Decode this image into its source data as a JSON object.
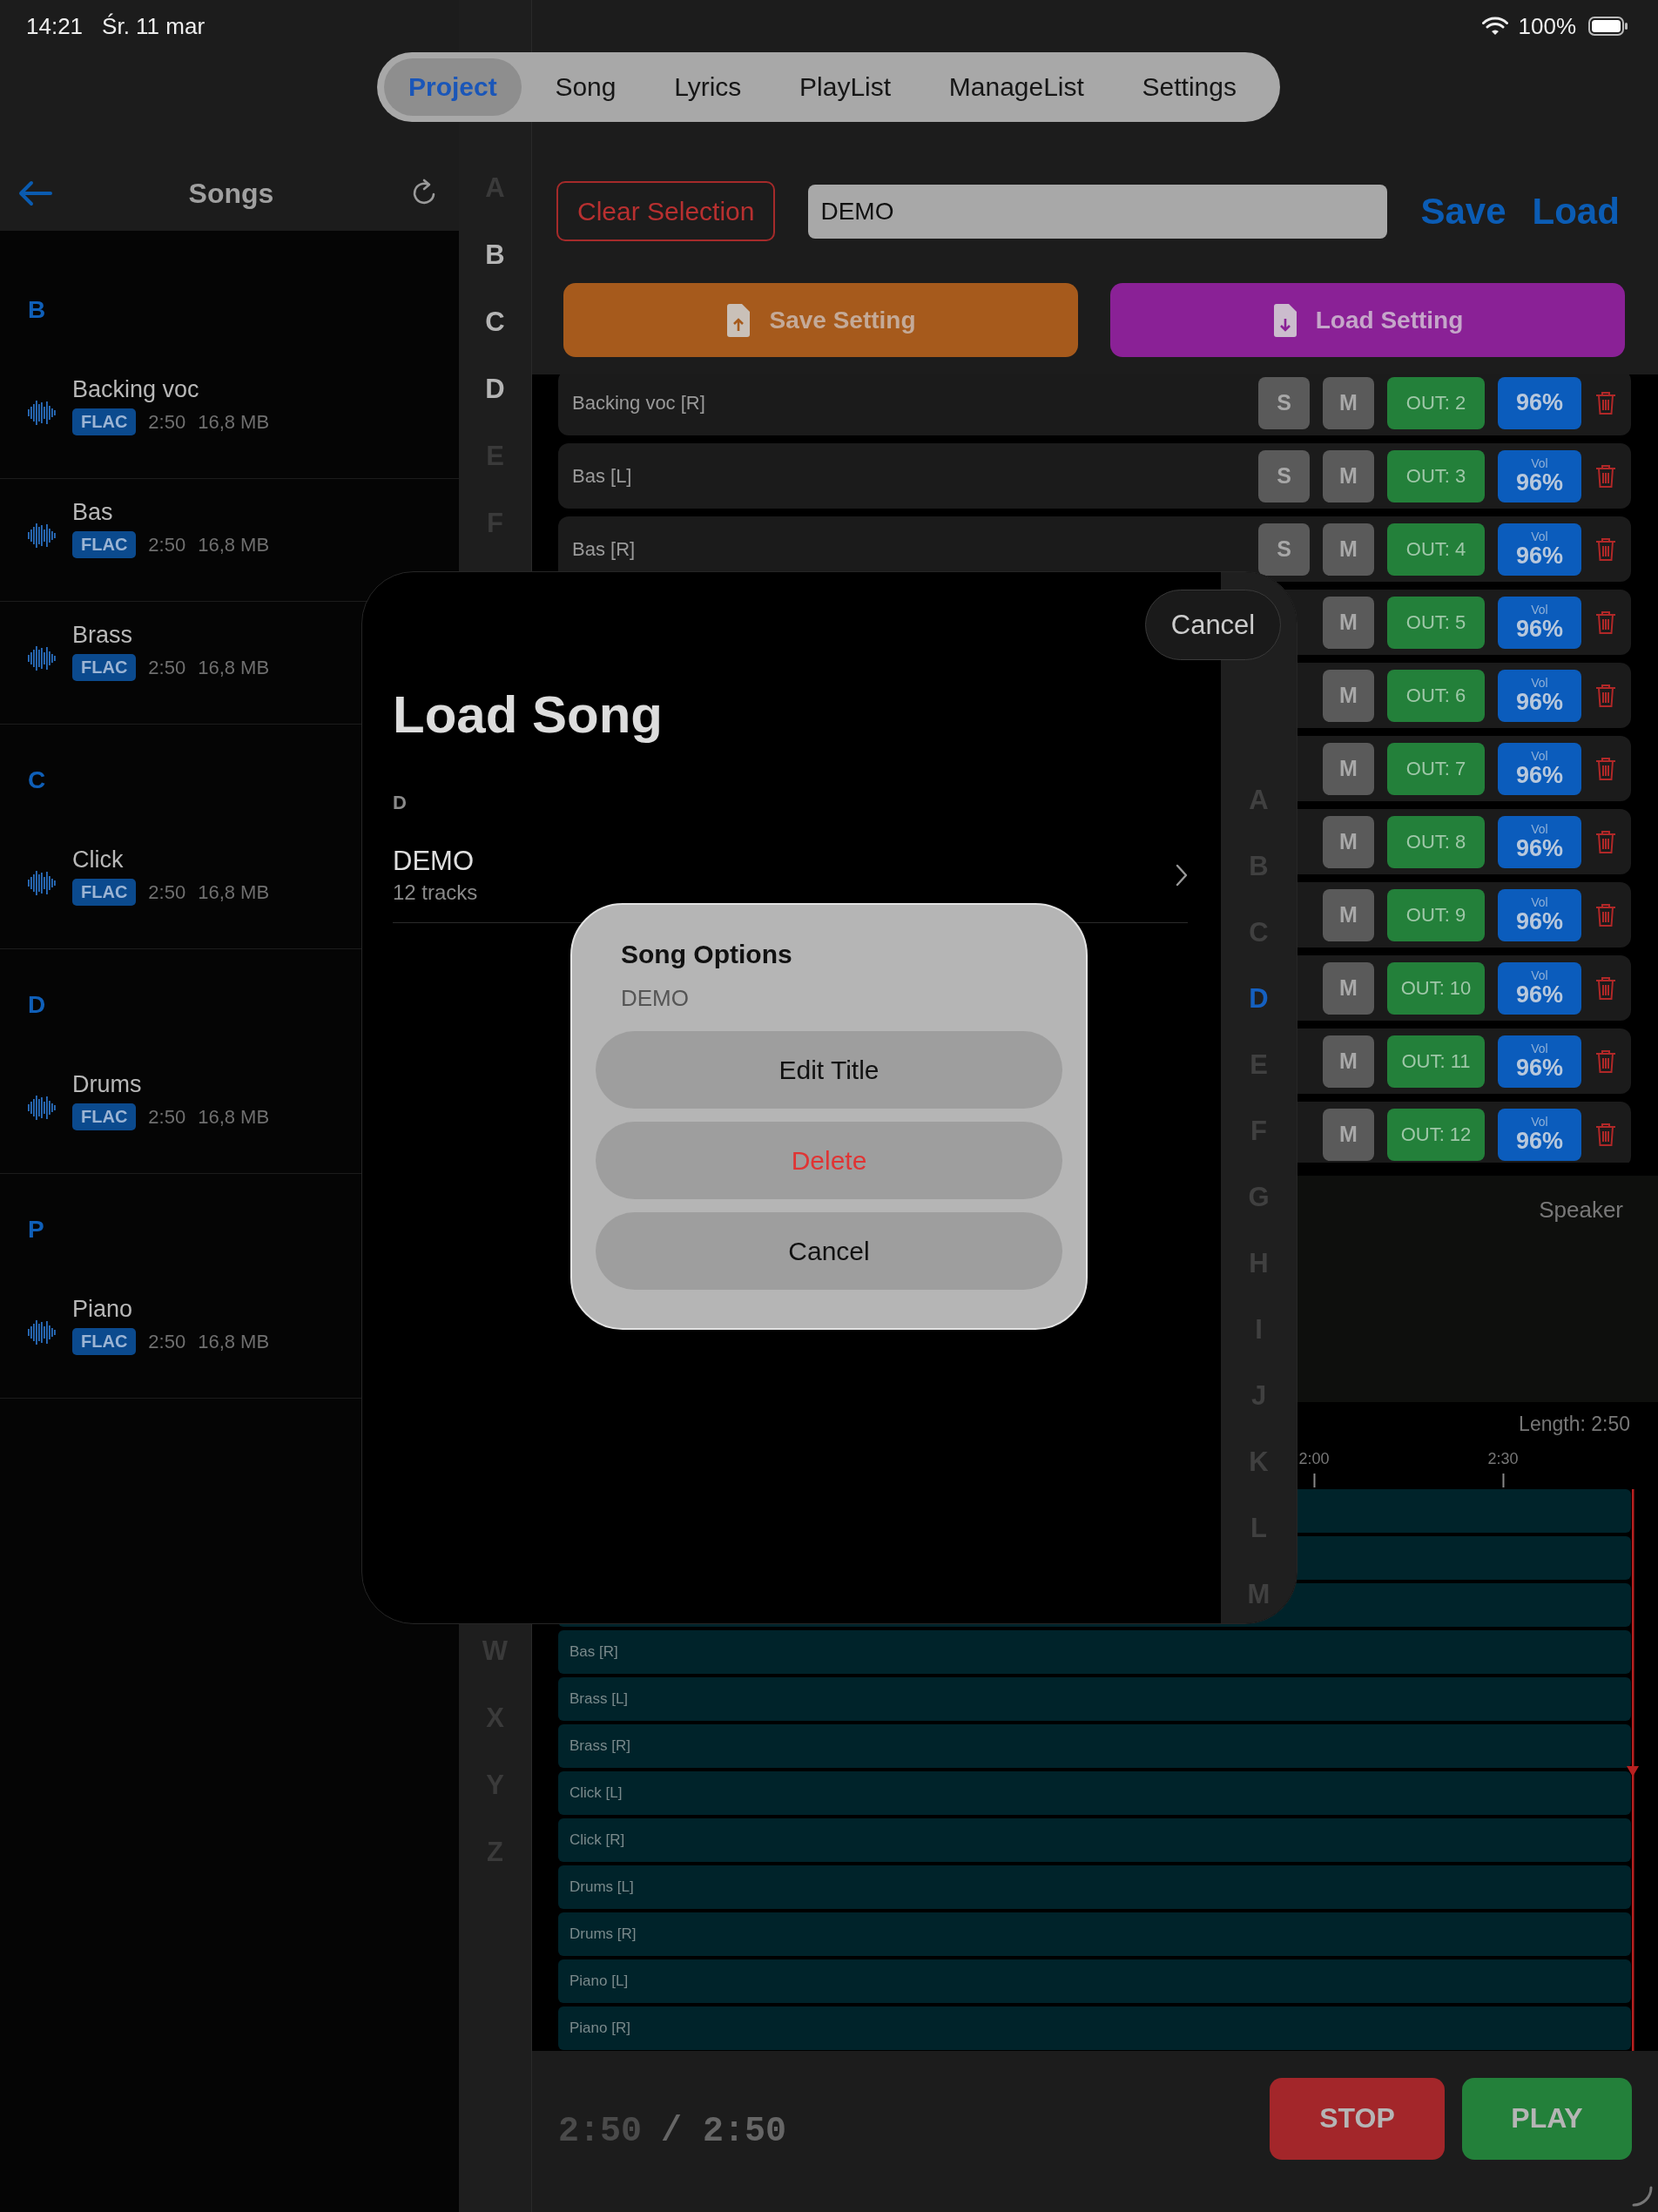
{
  "status_bar": {
    "time": "14:21",
    "date": "Śr. 11 mar",
    "battery": "100%"
  },
  "tabs": [
    {
      "label": "Project",
      "selected": true
    },
    {
      "label": "Song",
      "selected": false
    },
    {
      "label": "Lyrics",
      "selected": false
    },
    {
      "label": "PlayList",
      "selected": false
    },
    {
      "label": "ManageList",
      "selected": false
    },
    {
      "label": "Settings",
      "selected": false
    }
  ],
  "songs_sidebar": {
    "title": "Songs",
    "sections": [
      {
        "letter": "B",
        "songs": [
          {
            "name": "Backing voc",
            "format": "FLAC",
            "duration": "2:50",
            "size": "16,8 MB"
          },
          {
            "name": "Bas",
            "format": "FLAC",
            "duration": "2:50",
            "size": "16,8 MB"
          },
          {
            "name": "Brass",
            "format": "FLAC",
            "duration": "2:50",
            "size": "16,8 MB"
          }
        ]
      },
      {
        "letter": "C",
        "songs": [
          {
            "name": "Click",
            "format": "FLAC",
            "duration": "2:50",
            "size": "16,8 MB"
          }
        ]
      },
      {
        "letter": "D",
        "songs": [
          {
            "name": "Drums",
            "format": "FLAC",
            "duration": "2:50",
            "size": "16,8 MB"
          }
        ]
      },
      {
        "letter": "P",
        "songs": [
          {
            "name": "Piano",
            "format": "FLAC",
            "duration": "2:50",
            "size": "16,8 MB"
          }
        ]
      }
    ]
  },
  "index_top": [
    {
      "letter": "A",
      "enabled": false
    },
    {
      "letter": "B",
      "enabled": true
    },
    {
      "letter": "C",
      "enabled": true
    },
    {
      "letter": "D",
      "enabled": true
    },
    {
      "letter": "E",
      "enabled": false
    },
    {
      "letter": "F",
      "enabled": false
    }
  ],
  "index_bottom": [
    {
      "letter": "W",
      "enabled": false
    },
    {
      "letter": "X",
      "enabled": false
    },
    {
      "letter": "Y",
      "enabled": false
    },
    {
      "letter": "Z",
      "enabled": false
    }
  ],
  "project": {
    "clear_button": "Clear Selection",
    "name_value": "DEMO",
    "save": "Save",
    "load": "Load",
    "save_setting": "Save Setting",
    "load_setting": "Load Setting"
  },
  "tracks": [
    {
      "name": "Backing voc [R]",
      "solo": "S",
      "mute": "M",
      "output": "OUT: 2",
      "volume": "96%"
    },
    {
      "name": "Bas [L]",
      "solo": "S",
      "mute": "M",
      "output": "OUT: 3",
      "volume_caption": "Vol",
      "volume": "96%"
    },
    {
      "name": "Bas [R]",
      "solo": "S",
      "mute": "M",
      "output": "OUT: 4",
      "volume_caption": "Vol",
      "volume": "96%"
    },
    {
      "mute": "M",
      "output": "OUT: 5",
      "volume_caption": "Vol",
      "volume": "96%"
    },
    {
      "mute": "M",
      "output": "OUT: 6",
      "volume_caption": "Vol",
      "volume": "96%"
    },
    {
      "mute": "M",
      "output": "OUT: 7",
      "volume_caption": "Vol",
      "volume": "96%"
    },
    {
      "mute": "M",
      "output": "OUT: 8",
      "volume_caption": "Vol",
      "volume": "96%"
    },
    {
      "mute": "M",
      "output": "OUT: 9",
      "volume_caption": "Vol",
      "volume": "96%"
    },
    {
      "mute": "M",
      "output": "OUT: 10",
      "volume_caption": "Vol",
      "volume": "96%"
    },
    {
      "mute": "M",
      "output": "OUT: 11",
      "volume_caption": "Vol",
      "volume": "96%"
    },
    {
      "mute": "M",
      "output": "OUT: 12",
      "volume_caption": "Vol",
      "volume": "96%"
    }
  ],
  "output_panel": {
    "label": "Speaker"
  },
  "timeline": {
    "length": "Length: 2:50",
    "ticks": [
      "2:00",
      "2:30"
    ],
    "lanes": [
      {
        "kind": "blank"
      },
      {
        "kind": "blank"
      },
      {
        "kind": "blank"
      },
      {
        "kind": "labeled",
        "label": "Bas [R]"
      },
      {
        "kind": "labeled",
        "label": "Brass [L]"
      },
      {
        "kind": "labeled",
        "label": "Brass [R]"
      },
      {
        "kind": "labeled",
        "label": "Click [L]"
      },
      {
        "kind": "labeled",
        "label": "Click [R]"
      },
      {
        "kind": "labeled",
        "label": "Drums [L]"
      },
      {
        "kind": "labeled",
        "label": "Drums [R]"
      },
      {
        "kind": "labeled",
        "label": "Piano [L]"
      },
      {
        "kind": "labeled",
        "label": "Piano [R]"
      }
    ]
  },
  "transport": {
    "elapsed": "2:50",
    "total": "/ 2:50",
    "stop": "STOP",
    "play": "PLAY"
  },
  "load_song_sheet": {
    "cancel": "Cancel",
    "title": "Load Song",
    "sections": [
      {
        "letter": "D",
        "songs": [
          {
            "name": "DEMO",
            "tracks": "12 tracks"
          }
        ]
      }
    ],
    "index": [
      {
        "letter": "A",
        "selected": false
      },
      {
        "letter": "B",
        "selected": false
      },
      {
        "letter": "C",
        "selected": false
      },
      {
        "letter": "D",
        "selected": true
      },
      {
        "letter": "E",
        "selected": false
      },
      {
        "letter": "F",
        "selected": false
      },
      {
        "letter": "G",
        "selected": false
      },
      {
        "letter": "H",
        "selected": false
      },
      {
        "letter": "I",
        "selected": false
      },
      {
        "letter": "J",
        "selected": false
      },
      {
        "letter": "K",
        "selected": false
      },
      {
        "letter": "L",
        "selected": false
      },
      {
        "letter": "M",
        "selected": false
      }
    ]
  },
  "song_options_dialog": {
    "title": "Song Options",
    "subtitle": "DEMO",
    "actions": [
      {
        "label": "Edit Title",
        "kind": "default"
      },
      {
        "label": "Delete",
        "kind": "destructive"
      },
      {
        "label": "Cancel",
        "kind": "default"
      }
    ]
  }
}
